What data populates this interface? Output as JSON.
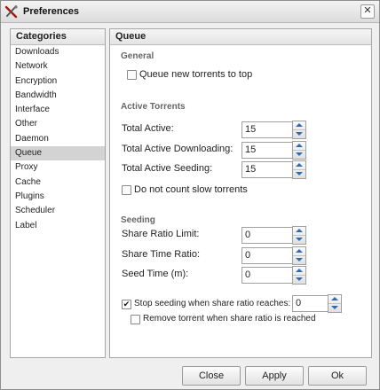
{
  "window": {
    "title": "Preferences"
  },
  "categories": {
    "header": "Categories",
    "items": [
      "Downloads",
      "Network",
      "Encryption",
      "Bandwidth",
      "Interface",
      "Other",
      "Daemon",
      "Queue",
      "Proxy",
      "Cache",
      "Plugins",
      "Scheduler",
      "Label"
    ],
    "selected": "Queue"
  },
  "queue": {
    "header": "Queue",
    "general": {
      "title": "General",
      "queue_new_top": {
        "label": "Queue new torrents to top",
        "checked": false
      }
    },
    "active": {
      "title": "Active Torrents",
      "total_active": {
        "label": "Total Active:",
        "value": "15"
      },
      "total_downloading": {
        "label": "Total Active Downloading:",
        "value": "15"
      },
      "total_seeding": {
        "label": "Total Active Seeding:",
        "value": "15"
      },
      "dont_count_slow": {
        "label": "Do not count slow torrents",
        "checked": false
      }
    },
    "seeding": {
      "title": "Seeding",
      "share_ratio_limit": {
        "label": "Share Ratio Limit:",
        "value": "0"
      },
      "share_time_ratio": {
        "label": "Share Time Ratio:",
        "value": "0"
      },
      "seed_time": {
        "label": "Seed Time (m):",
        "value": "0"
      },
      "stop_seeding": {
        "label": "Stop seeding when share ratio reaches:",
        "checked": true,
        "value": "0"
      },
      "remove_torrent": {
        "label": "Remove torrent when share ratio is reached",
        "checked": false
      }
    }
  },
  "buttons": {
    "close": "Close",
    "apply": "Apply",
    "ok": "Ok"
  },
  "icons": {
    "app": "tools-icon",
    "window_close": "close-icon",
    "spin_up": "arrow-up-icon",
    "spin_down": "arrow-down-icon",
    "check": "checkmark-icon"
  }
}
